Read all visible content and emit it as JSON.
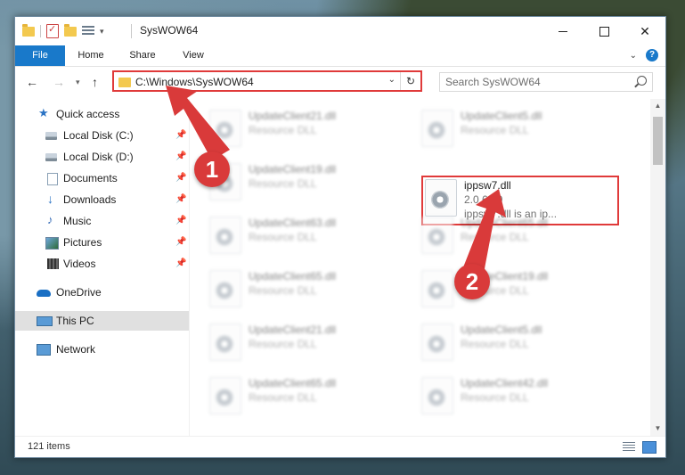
{
  "window": {
    "title": "SysWOW64",
    "minimize": "",
    "maximize": "",
    "close": "✕"
  },
  "ribbon": {
    "tabs": [
      {
        "label": "File"
      },
      {
        "label": "Home"
      },
      {
        "label": "Share"
      },
      {
        "label": "View"
      }
    ]
  },
  "address": {
    "path": "C:\\Windows\\SysWOW64"
  },
  "search": {
    "placeholder": "Search SysWOW64"
  },
  "sidebar": {
    "items": [
      {
        "label": "Quick access",
        "icon": "star-icon"
      },
      {
        "label": "Local Disk (C:)",
        "icon": "drive-icon",
        "pinned": true
      },
      {
        "label": "Local Disk (D:)",
        "icon": "drive-icon",
        "pinned": true
      },
      {
        "label": "Documents",
        "icon": "document-icon",
        "pinned": true
      },
      {
        "label": "Downloads",
        "icon": "download-icon",
        "pinned": true
      },
      {
        "label": "Music",
        "icon": "music-icon",
        "pinned": true
      },
      {
        "label": "Pictures",
        "icon": "pictures-icon",
        "pinned": true
      },
      {
        "label": "Videos",
        "icon": "video-icon",
        "pinned": true
      },
      {
        "label": "OneDrive",
        "icon": "cloud-icon"
      },
      {
        "label": "This PC",
        "icon": "pc-icon",
        "selected": true
      },
      {
        "label": "Network",
        "icon": "network-icon"
      }
    ]
  },
  "files": {
    "left": [
      {
        "name": "UpdateClient21.dll",
        "type": "Resource DLL"
      },
      {
        "name": "UpdateClient19.dll",
        "type": "Resource DLL"
      },
      {
        "name": "UpdateClient63.dll",
        "type": "Resource DLL"
      },
      {
        "name": "UpdateClient65.dll",
        "type": "Resource DLL"
      },
      {
        "name": "UpdateClient21.dll",
        "type": "Resource DLL"
      },
      {
        "name": "UpdateClient65.dll",
        "type": "Resource DLL"
      }
    ],
    "right": [
      {
        "name": "UpdateClient5.dll",
        "type": "Resource DLL"
      },
      {
        "name": "UpdateClient65.dll",
        "type": "Resource DLL"
      },
      {
        "name": "UpdateClient19.dll",
        "type": "Resource DLL"
      },
      {
        "name": "UpdateClient5.dll",
        "type": "Resource DLL"
      },
      {
        "name": "UpdateClient42.dll",
        "type": "Resource DLL"
      }
    ],
    "highlighted": {
      "name": "ippsw7.dll",
      "version": "2.0.6.39",
      "description": "ippsw7.dll is an ip..."
    }
  },
  "status": {
    "item_count": "121 items"
  },
  "callouts": {
    "one": "1",
    "two": "2"
  },
  "colors": {
    "accent": "#1979ca",
    "highlight": "#e03a3a"
  }
}
